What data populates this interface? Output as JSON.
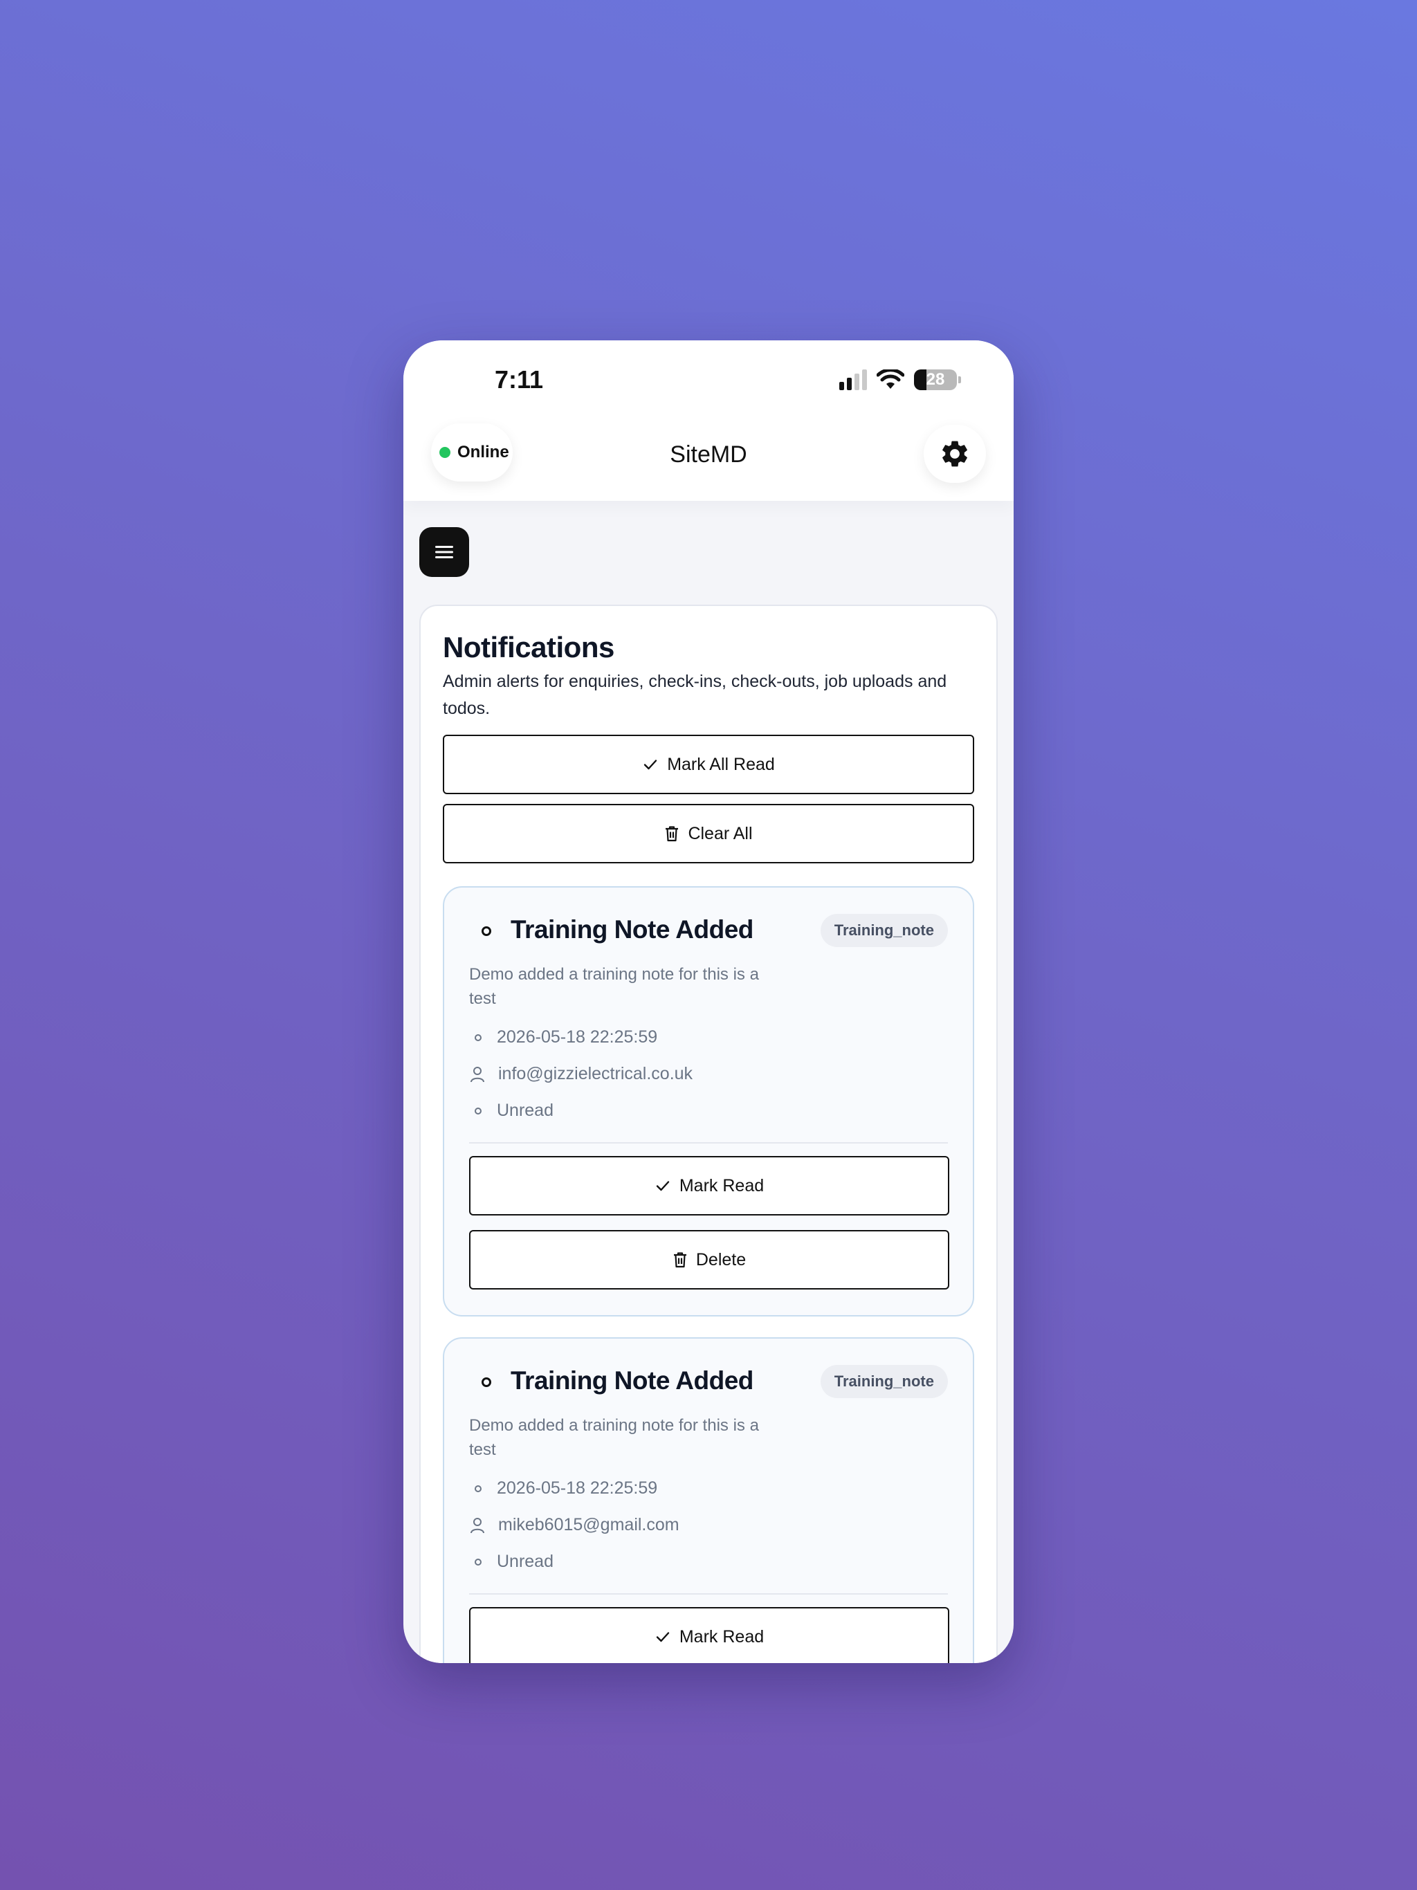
{
  "status_bar": {
    "time": "7:11",
    "battery": "28"
  },
  "header": {
    "online_label": "Online",
    "title": "SiteMD",
    "settings_icon": "gear-icon",
    "menu_icon": "hamburger-menu-icon"
  },
  "notifications": {
    "title": "Notifications",
    "description": "Admin alerts for enquiries, check-ins, check-outs, job uploads and todos.",
    "mark_all_label": "Mark All Read",
    "clear_all_label": "Clear All",
    "items": [
      {
        "title": "Training Note Added",
        "tag": "Training_note",
        "description": "Demo added a training note for this is a test",
        "timestamp": "2026-05-18 22:25:59",
        "user": "info@gizzielectrical.co.uk",
        "status": "Unread",
        "mark_read_label": "Mark Read",
        "delete_label": "Delete"
      },
      {
        "title": "Training Note Added",
        "tag": "Training_note",
        "description": "Demo added a training note for this is a test",
        "timestamp": "2026-05-18 22:25:59",
        "user": "mikeb6015@gmail.com",
        "status": "Unread",
        "mark_read_label": "Mark Read"
      }
    ]
  },
  "colors": {
    "online": "#22c55e",
    "accent_border": "#c8ddf0",
    "background_top": "#6a78e0",
    "background_bottom": "#7452b0"
  }
}
